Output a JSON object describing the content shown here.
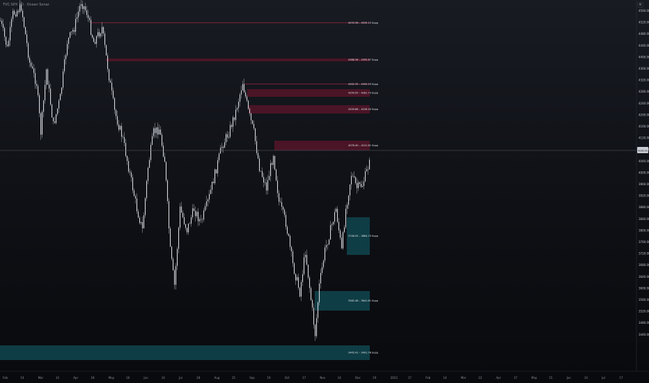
{
  "header": {
    "symbol_title": "TVC:SPX 1D · Ocean Sonar"
  },
  "settings_icon": "gear-icon",
  "colors": {
    "supply_zone": "#4a1526",
    "supply_line": "#6d2035",
    "demand_zone": "#0f3d45",
    "candles": "#d7dae0",
    "last_price_line": "#5a5f6a",
    "last_price_tag": "#c9ccd3"
  },
  "price_axis": {
    "ticks": [
      "4560.00",
      "4520.00",
      "4480.00",
      "4440.00",
      "4400.00",
      "4360.00",
      "4320.00",
      "4280.00",
      "4240.00",
      "4200.00",
      "4160.00",
      "4120.00",
      "4080.00",
      "4040.00",
      "4000.00",
      "3960.00",
      "3920.00",
      "3880.00",
      "3840.00",
      "3800.00",
      "3760.00",
      "3720.00",
      "3680.00",
      "3640.00",
      "3600.00",
      "3560.00",
      "3520.00",
      "3480.00",
      "3440.00"
    ],
    "last_price": "4080.00"
  },
  "time_axis": {
    "ticks": [
      "Feb",
      "14",
      "Mar",
      "14",
      "Apr",
      "18",
      "May",
      "16",
      "Jun",
      "14",
      "Jul",
      "18",
      "Aug",
      "15",
      "Sep",
      "19",
      "Oct",
      "17",
      "Nov",
      "14",
      "Dec",
      "19",
      "2023",
      "17",
      "Feb",
      "14",
      "Mar",
      "22",
      "Apr",
      "17",
      "May",
      "15",
      "Jun",
      "14",
      "Jul",
      "17"
    ]
  },
  "zones": [
    {
      "kind": "supply",
      "label": "4533.36 – 4535.15 Supp"
    },
    {
      "kind": "supply",
      "label": "4388.36 – 4395.87 Supp"
    },
    {
      "kind": "supply",
      "label": "4302.35 – 4305.29 Supp"
    },
    {
      "kind": "supply",
      "label": "4259.95 – 4281.73 Supp"
    },
    {
      "kind": "supply",
      "label": "4200.86 – 4226.40 Supp"
    },
    {
      "kind": "supply",
      "label": "4078.40 – 4101.81 Supp"
    },
    {
      "kind": "demand",
      "label": "3748.55 – 3864.75 Supp"
    },
    {
      "kind": "demand",
      "label": "3582.48 – 3641.81 Supp"
    },
    {
      "kind": "demand",
      "label": "3445.41 – 3491.76 Supp"
    }
  ]
}
